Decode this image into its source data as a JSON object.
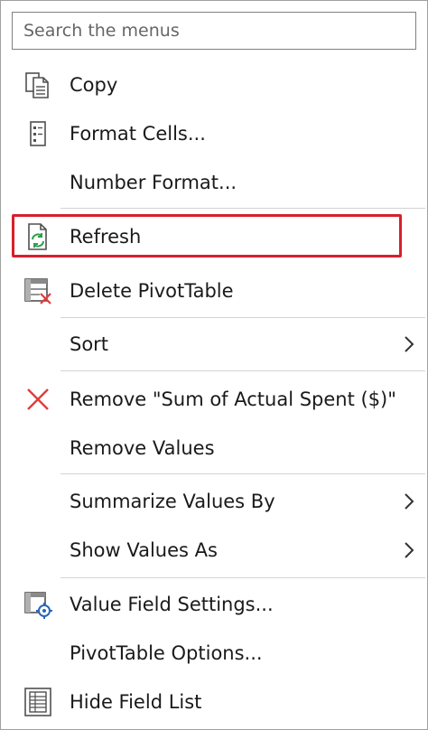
{
  "search": {
    "placeholder": "Search the menus"
  },
  "items": [
    {
      "label": "Copy",
      "icon": "copy-icon"
    },
    {
      "label": "Format Cells...",
      "icon": "format-cells-icon"
    },
    {
      "label": "Number Format..."
    },
    {
      "label": "Refresh",
      "icon": "refresh-icon",
      "highlighted": true
    },
    {
      "label": "Delete PivotTable",
      "icon": "delete-pivottable-icon"
    },
    {
      "label": "Sort",
      "submenu": true
    },
    {
      "label": "Remove \"Sum of Actual Spent ($)\"",
      "icon": "remove-x-icon"
    },
    {
      "label": "Remove Values"
    },
    {
      "label": "Summarize Values By",
      "submenu": true
    },
    {
      "label": "Show Values As",
      "submenu": true
    },
    {
      "label": "Value Field Settings...",
      "icon": "value-field-settings-icon"
    },
    {
      "label": "PivotTable Options..."
    },
    {
      "label": "Hide Field List",
      "icon": "field-list-icon"
    }
  ],
  "colors": {
    "highlight_border": "#d6202b",
    "remove_x": "#e03c3c",
    "refresh_green": "#2e9e4f",
    "icon_gray": "#505050"
  }
}
